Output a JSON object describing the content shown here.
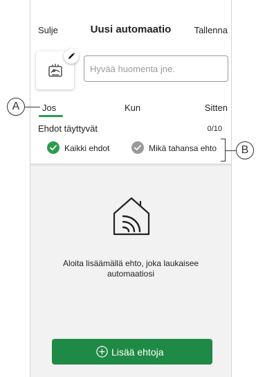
{
  "nav": {
    "close_label": "Sulje",
    "title": "Uusi automaatio",
    "save_label": "Tallenna"
  },
  "name_field": {
    "placeholder": "Hyvää huomenta jne.",
    "value": ""
  },
  "tabs": [
    {
      "label": "Jos",
      "active": true
    },
    {
      "label": "Kun",
      "active": false
    },
    {
      "label": "Sitten",
      "active": false
    }
  ],
  "conditions": {
    "title": "Ehdot täyttyvät",
    "count": "0/10",
    "options": [
      {
        "label": "Kaikki ehdot",
        "selected": true
      },
      {
        "label": "Mikä tahansa ehto",
        "selected": false
      }
    ]
  },
  "empty_state": {
    "icon": "home-signal-icon",
    "text": "Aloita lisäämällä ehto, joka laukaisee automaatiosi"
  },
  "add_button": {
    "label": "Lisää ehtoja",
    "icon": "plus-circle-icon"
  },
  "callouts": {
    "a": "A",
    "b": "B"
  },
  "colors": {
    "accent_green": "#2e9b4e",
    "button_green": "#1f8a45",
    "unselected_gray": "#9a9a9a",
    "screen_background": "#f2f2f2"
  }
}
